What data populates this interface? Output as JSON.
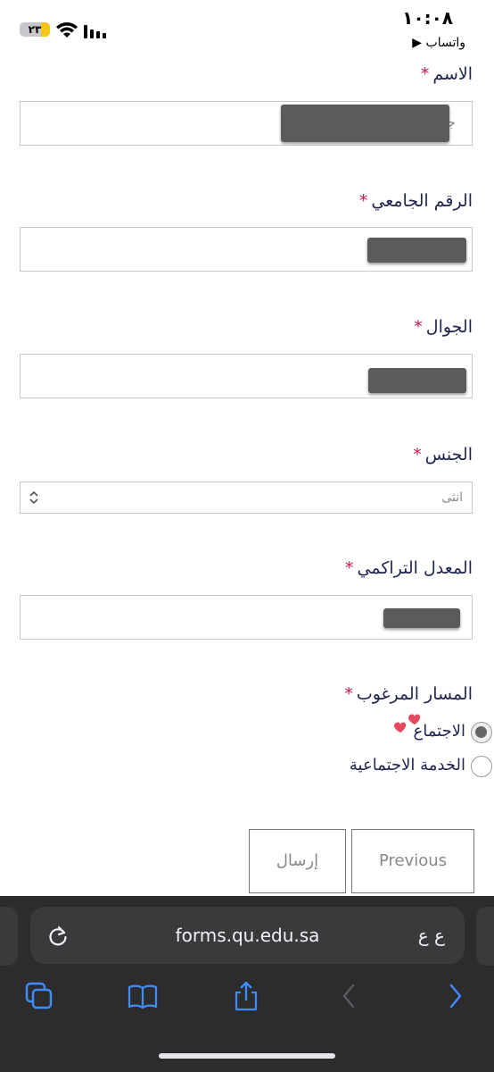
{
  "status_bar": {
    "time": "١٠:٠٨",
    "back_app": "▶ واتساب",
    "battery": "٢٣"
  },
  "form": {
    "name": {
      "label": "الاسم",
      "value": "جنى"
    },
    "student_id": {
      "label": "الرقم الجامعي"
    },
    "mobile": {
      "label": "الجوال"
    },
    "gender": {
      "label": "الجنس",
      "value": "انثى"
    },
    "gpa": {
      "label": "المعدل التراكمي"
    },
    "track": {
      "label": "المسار المرغوب",
      "options": [
        {
          "label": "الاجتماع",
          "checked": true
        },
        {
          "label": "الخدمة الاجتماعية",
          "checked": false
        }
      ]
    },
    "required_marker": "*",
    "buttons": {
      "previous": "Previous",
      "submit": "إرسال"
    }
  },
  "browser": {
    "url": "forms.qu.edu.sa",
    "text_size": "ع ع"
  }
}
